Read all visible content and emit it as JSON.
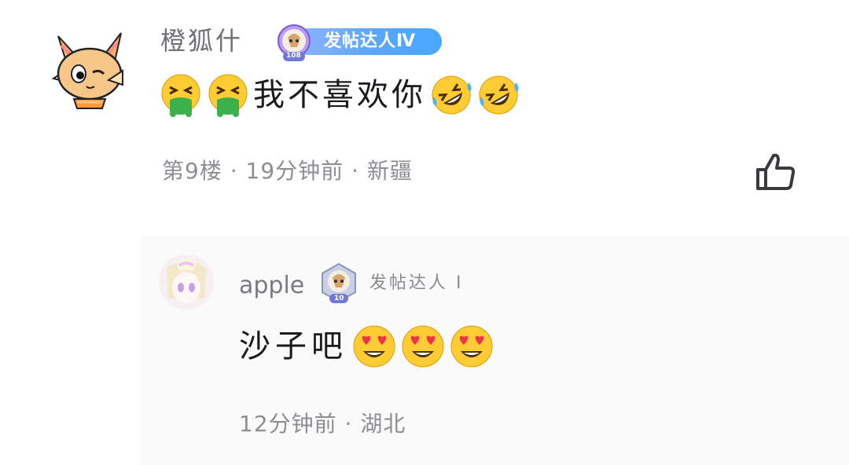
{
  "comment": {
    "username": "橙狐什",
    "badge": {
      "label": "发帖达人Ⅳ",
      "level": "108"
    },
    "text": "我不喜欢你",
    "leading_emojis": [
      "face-vomiting",
      "face-vomiting"
    ],
    "trailing_emojis": [
      "rolling-on-floor-laughing",
      "rolling-on-floor-laughing"
    ],
    "meta": "第9楼 · 19分钟前 · 新疆",
    "like_icon": "thumbs-up-outline"
  },
  "reply": {
    "username": "apple",
    "badge": {
      "label": "发帖达人 Ⅰ",
      "level": "10"
    },
    "text": "沙子吧",
    "trailing_emojis": [
      "smiling-face-with-heart-eyes",
      "smiling-face-with-heart-eyes",
      "smiling-face-with-heart-eyes"
    ],
    "meta": "12分钟前 · 湖北"
  },
  "colors": {
    "badge_gradient_start": "#8fb4ff",
    "badge_gradient_end": "#49a7ff",
    "meta_text": "#8d8d93",
    "content_text": "#1b1b1f",
    "reply_background": "#fafafa"
  }
}
